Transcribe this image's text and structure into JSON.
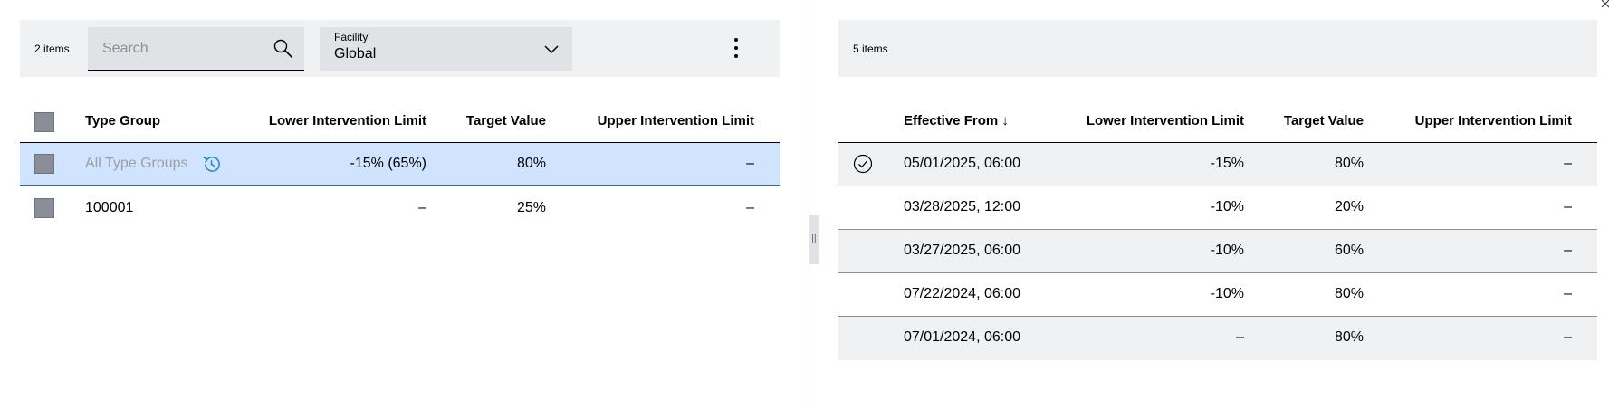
{
  "left": {
    "item_count": "2 items",
    "search": {
      "placeholder": "Search"
    },
    "facility": {
      "label": "Facility",
      "value": "Global"
    },
    "columns": {
      "type_group": "Type Group",
      "lower": "Lower Intervention Limit",
      "target": "Target Value",
      "upper": "Upper Intervention Limit"
    },
    "rows": [
      {
        "type_group": "All Type Groups",
        "lower": "-15% (65%)",
        "target": "80%",
        "upper": "–"
      },
      {
        "type_group": "100001",
        "lower": "–",
        "target": "25%",
        "upper": "–"
      }
    ]
  },
  "right": {
    "item_count": "5 items",
    "columns": {
      "effective_from": "Effective From ↓",
      "lower": "Lower Intervention Limit",
      "target": "Target Value",
      "upper": "Upper Intervention Limit"
    },
    "rows": [
      {
        "effective_from": "05/01/2025, 06:00",
        "lower": "-15%",
        "target": "80%",
        "upper": "–"
      },
      {
        "effective_from": "03/28/2025, 12:00",
        "lower": "-10%",
        "target": "20%",
        "upper": "–"
      },
      {
        "effective_from": "03/27/2025, 06:00",
        "lower": "-10%",
        "target": "60%",
        "upper": "–"
      },
      {
        "effective_from": "07/22/2024, 06:00",
        "lower": "-10%",
        "target": "80%",
        "upper": "–"
      },
      {
        "effective_from": "07/01/2024, 06:00",
        "lower": "–",
        "target": "80%",
        "upper": "–"
      }
    ]
  },
  "splitter": {
    "glyph": "||"
  },
  "colors": {
    "selected_row": "#d1e4ff",
    "toolbar_bg": "#eff1f2",
    "accent_icon": "#2a87c2"
  }
}
